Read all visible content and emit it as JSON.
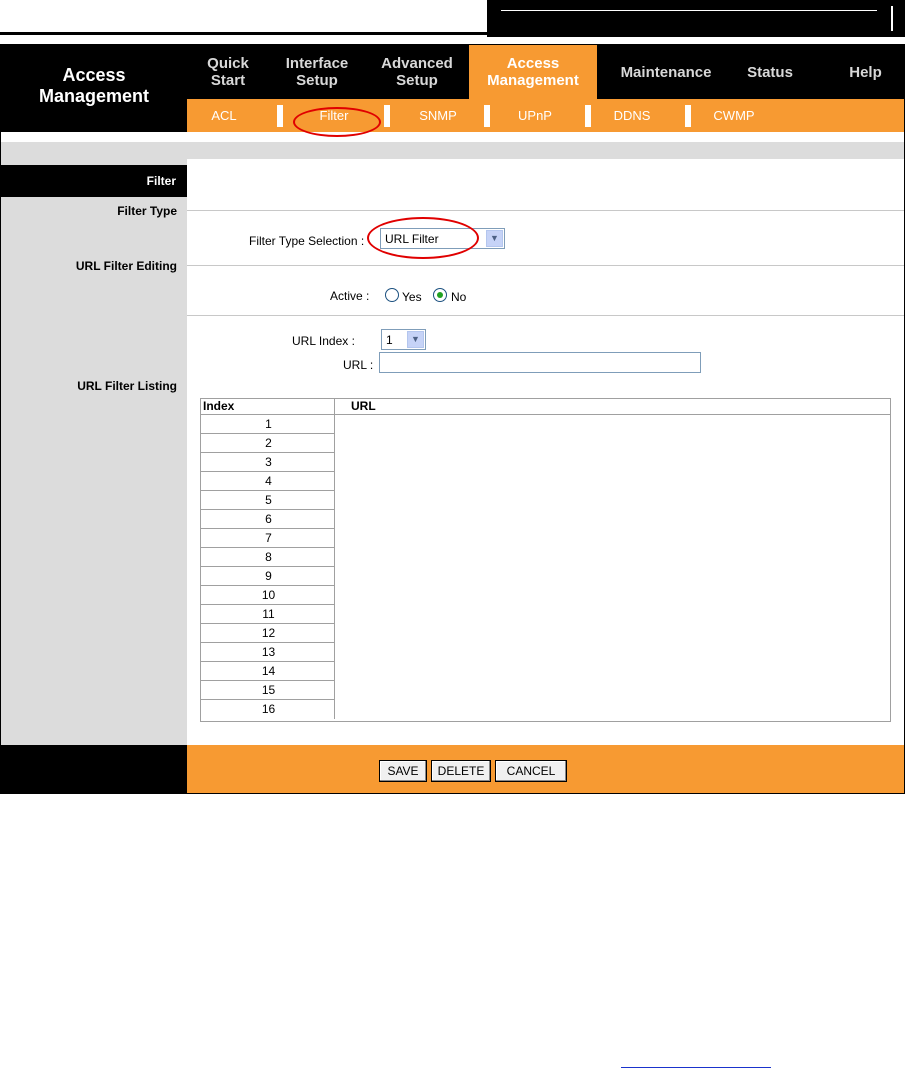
{
  "brand": {
    "line1": "Access",
    "line2": "Management"
  },
  "topnav": [
    {
      "line1": "Quick",
      "line2": "Start"
    },
    {
      "line1": "Interface",
      "line2": "Setup"
    },
    {
      "line1": "Advanced",
      "line2": "Setup"
    },
    {
      "line1": "Access",
      "line2": "Management"
    },
    {
      "line1": "Maintenance",
      "line2": ""
    },
    {
      "line1": "Status",
      "line2": ""
    },
    {
      "line1": "Help",
      "line2": ""
    }
  ],
  "subnav": [
    "ACL",
    "Filter",
    "SNMP",
    "UPnP",
    "DDNS",
    "CWMP"
  ],
  "sections": {
    "filter": "Filter",
    "filter_type": "Filter Type",
    "url_editing": "URL Filter Editing",
    "url_listing": "URL Filter Listing"
  },
  "form": {
    "filter_type_label": "Filter Type Selection :",
    "filter_type_value": "URL Filter",
    "active_label": "Active :",
    "yes_label": "Yes",
    "no_label": "No",
    "url_index_label": "URL Index :",
    "url_index_value": "1",
    "url_label": "URL :",
    "url_value": ""
  },
  "table": {
    "headers": {
      "index": "Index",
      "url": "URL"
    },
    "rows": [
      "1",
      "2",
      "3",
      "4",
      "5",
      "6",
      "7",
      "8",
      "9",
      "10",
      "11",
      "12",
      "13",
      "14",
      "15",
      "16"
    ]
  },
  "buttons": {
    "save": "SAVE",
    "delete": "DELETE",
    "cancel": "CANCEL"
  },
  "colors": {
    "accent": "#f79a32",
    "nav_bg": "#000000",
    "side_bg": "#dcdcdc",
    "highlight_ring": "#e00000"
  }
}
